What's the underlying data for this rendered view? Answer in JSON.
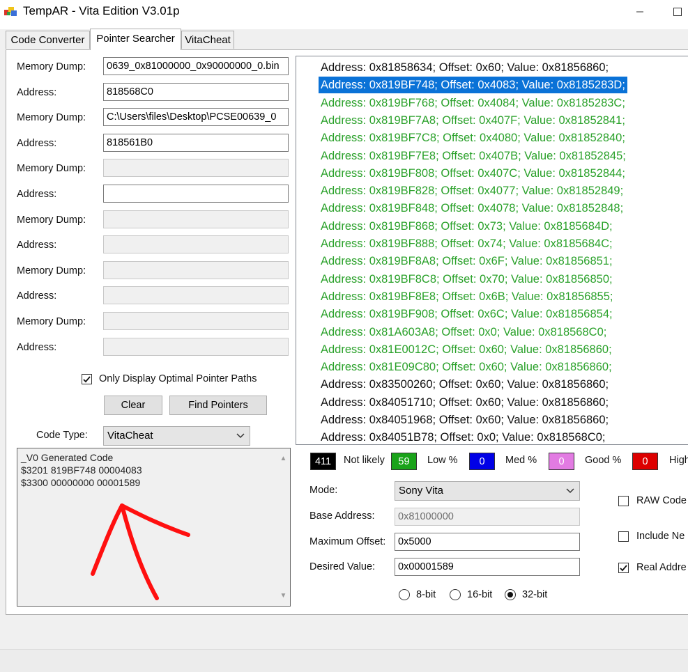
{
  "window": {
    "title": "TempAR - Vita Edition  V3.01p",
    "minimize_icon": "minimize-icon",
    "maximize_icon": "maximize-icon"
  },
  "tabs": [
    {
      "label": "Code Converter",
      "active": false
    },
    {
      "label": "Pointer Searcher",
      "active": true
    },
    {
      "label": "VitaCheat",
      "active": false
    }
  ],
  "dump_rows": [
    {
      "label": "Memory Dump:",
      "value": "0639_0x81000000_0x90000000_0.bin",
      "enabled": true
    },
    {
      "label": "Address:",
      "value": "818568C0",
      "enabled": true
    },
    {
      "label": "Memory Dump:",
      "value": "C:\\Users\\files\\Desktop\\PCSE00639_0",
      "enabled": true
    },
    {
      "label": "Address:",
      "value": "818561B0",
      "enabled": true
    },
    {
      "label": "Memory Dump:",
      "value": "",
      "enabled": false
    },
    {
      "label": "Address:",
      "value": "",
      "enabled": true
    },
    {
      "label": "Memory Dump:",
      "value": "",
      "enabled": false
    },
    {
      "label": "Address:",
      "value": "",
      "enabled": false
    },
    {
      "label": "Memory Dump:",
      "value": "",
      "enabled": false
    },
    {
      "label": "Address:",
      "value": "",
      "enabled": false
    },
    {
      "label": "Memory Dump:",
      "value": "",
      "enabled": false
    },
    {
      "label": "Address:",
      "value": "",
      "enabled": false
    }
  ],
  "optimal": {
    "label": "Only Display Optimal  Pointer Paths",
    "checked": true
  },
  "buttons": {
    "clear": "Clear",
    "find": "Find Pointers"
  },
  "code_type": {
    "label": "Code Type:",
    "value": "VitaCheat"
  },
  "generated_code": [
    "_V0 Generated Code",
    "$3201 819BF748 00004083",
    "$3300 00000000 00001589"
  ],
  "results": [
    {
      "text": "Address: 0x81858634; Offset: 0x60; Value: 0x81856860;",
      "color": "black"
    },
    {
      "text": "Address: 0x819BF748; Offset: 0x4083; Value: 0x8185283D;",
      "color": "selected"
    },
    {
      "text": "Address: 0x819BF768; Offset: 0x4084; Value: 0x8185283C;",
      "color": "green"
    },
    {
      "text": "Address: 0x819BF7A8; Offset: 0x407F; Value: 0x81852841;",
      "color": "green"
    },
    {
      "text": "Address: 0x819BF7C8; Offset: 0x4080; Value: 0x81852840;",
      "color": "green"
    },
    {
      "text": "Address: 0x819BF7E8; Offset: 0x407B; Value: 0x81852845;",
      "color": "green"
    },
    {
      "text": "Address: 0x819BF808; Offset: 0x407C; Value: 0x81852844;",
      "color": "green"
    },
    {
      "text": "Address: 0x819BF828; Offset: 0x4077; Value: 0x81852849;",
      "color": "green"
    },
    {
      "text": "Address: 0x819BF848; Offset: 0x4078; Value: 0x81852848;",
      "color": "green"
    },
    {
      "text": "Address: 0x819BF868; Offset: 0x73; Value: 0x8185684D;",
      "color": "green"
    },
    {
      "text": "Address: 0x819BF888; Offset: 0x74; Value: 0x8185684C;",
      "color": "green"
    },
    {
      "text": "Address: 0x819BF8A8; Offset: 0x6F; Value: 0x81856851;",
      "color": "green"
    },
    {
      "text": "Address: 0x819BF8C8; Offset: 0x70; Value: 0x81856850;",
      "color": "green"
    },
    {
      "text": "Address: 0x819BF8E8; Offset: 0x6B; Value: 0x81856855;",
      "color": "green"
    },
    {
      "text": "Address: 0x819BF908; Offset: 0x6C; Value: 0x81856854;",
      "color": "green"
    },
    {
      "text": "Address: 0x81A603A8; Offset: 0x0; Value: 0x818568C0;",
      "color": "green"
    },
    {
      "text": "Address: 0x81E0012C; Offset: 0x60; Value: 0x81856860;",
      "color": "green"
    },
    {
      "text": "Address: 0x81E09C80; Offset: 0x60; Value: 0x81856860;",
      "color": "green"
    },
    {
      "text": "Address: 0x83500260; Offset: 0x60; Value: 0x81856860;",
      "color": "black"
    },
    {
      "text": "Address: 0x84051710; Offset: 0x60; Value: 0x81856860;",
      "color": "black"
    },
    {
      "text": "Address: 0x84051968; Offset: 0x60; Value: 0x81856860;",
      "color": "black"
    },
    {
      "text": "Address: 0x84051B78; Offset: 0x0; Value: 0x818568C0;",
      "color": "black"
    }
  ],
  "legend": [
    {
      "count": "411",
      "label": "Not likely",
      "color": "#000000"
    },
    {
      "count": "59",
      "label": "Low %",
      "color": "#1aa31a"
    },
    {
      "count": "0",
      "label": "Med %",
      "color": "#0000e6"
    },
    {
      "count": "0",
      "label": "Good %",
      "color": "#e27be2"
    },
    {
      "count": "0",
      "label": "High",
      "color": "#dd0000"
    }
  ],
  "settings": {
    "mode_label": "Mode:",
    "mode_value": "Sony Vita",
    "base_label": "Base Address:",
    "base_value": "0x81000000",
    "maxoff_label": "Maximum Offset:",
    "maxoff_value": "0x5000",
    "desired_label": "Desired Value:",
    "desired_value": "0x00001589"
  },
  "bit_options": [
    {
      "label": "8-bit",
      "selected": false
    },
    {
      "label": "16-bit",
      "selected": false
    },
    {
      "label": "32-bit",
      "selected": true
    }
  ],
  "right_checks": [
    {
      "label": "RAW Code",
      "checked": false
    },
    {
      "label": "Include Ne",
      "checked": false
    },
    {
      "label": "Real Addre",
      "checked": true
    }
  ],
  "annotation": {
    "color": "#ff0000",
    "meaning": "red hand-drawn arrow pointing to generated code"
  }
}
